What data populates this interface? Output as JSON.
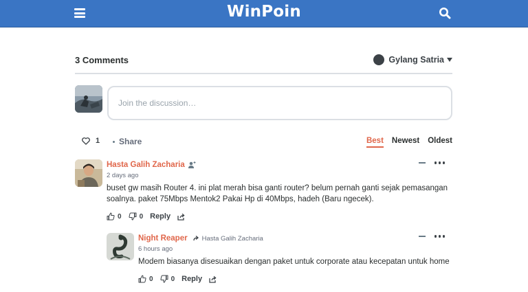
{
  "site": {
    "logo": "WinPoin"
  },
  "header": {
    "comment_count": "3 Comments",
    "user_name": "Gylang Satria"
  },
  "composer": {
    "placeholder": "Join the discussion…"
  },
  "toolbar": {
    "recommend_count": "1",
    "share_label": "Share",
    "sort": [
      "Best",
      "Newest",
      "Oldest"
    ],
    "active_sort": "Best"
  },
  "comments": [
    {
      "author": "Hasta Galih Zacharia",
      "time": "2 days ago",
      "text": "buset gw masih Router 4. ini plat merah bisa ganti router? belum pernah ganti sejak pemasangan soalnya. paket 75Mbps Mentok2 Pakai Hp di 40Mbps, hadeh (Baru ngecek).",
      "upvotes": "0",
      "downvotes": "0",
      "reply_label": "Reply"
    },
    {
      "author": "Night Reaper",
      "reply_to": "Hasta Galih Zacharia",
      "time": "6 hours ago",
      "text": "Modem biasanya disesuaikan dengan paket untuk corporate atau kecepatan untuk home",
      "upvotes": "0",
      "downvotes": "0",
      "reply_label": "Reply"
    }
  ],
  "colors": {
    "topbar": "#3a75c4",
    "accent": "#e0664a",
    "border": "#dbdfe4"
  }
}
